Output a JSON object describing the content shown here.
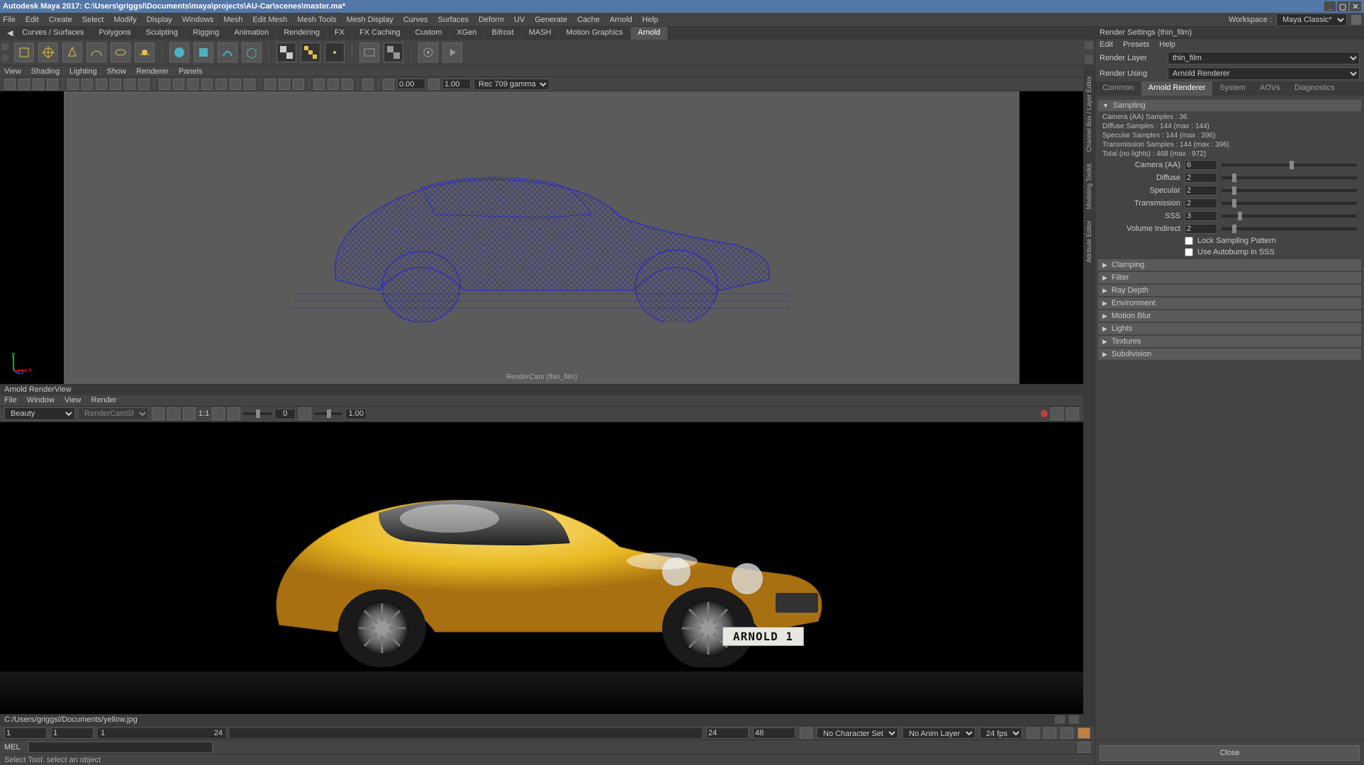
{
  "title_bar": "Autodesk Maya 2017: C:\\Users\\griggsl\\Documents\\maya\\projects\\AU-Car\\scenes\\master.ma*",
  "menus": [
    "File",
    "Edit",
    "Create",
    "Select",
    "Modify",
    "Display",
    "Windows",
    "Mesh",
    "Edit Mesh",
    "Mesh Tools",
    "Mesh Display",
    "Curves",
    "Surfaces",
    "Deform",
    "UV",
    "Generate",
    "Cache",
    "Arnold",
    "Help"
  ],
  "workspace": {
    "label": "Workspace :",
    "value": "Maya Classic*"
  },
  "shelf_tabs": [
    "Curves / Surfaces",
    "Polygons",
    "Sculpting",
    "Rigging",
    "Animation",
    "Rendering",
    "FX",
    "FX Caching",
    "Custom",
    "XGen",
    "Bifrost",
    "MASH",
    "Motion Graphics",
    "Arnold"
  ],
  "shelf_active": "Arnold",
  "viewport_menus": [
    "View",
    "Shading",
    "Lighting",
    "Show",
    "Renderer",
    "Panels"
  ],
  "viewport_toolbar": {
    "exposure": "0.00",
    "gamma": "1.00",
    "colorspace": "Rec 709 gamma"
  },
  "viewport_cam_label": "RenderCam (thin_film)",
  "side_tabs": [
    "Channel Box / Layer Editor",
    "Modeling Toolkit",
    "Attribute Editor"
  ],
  "renderview": {
    "title": "Arnold RenderView",
    "menus": [
      "File",
      "Window",
      "View",
      "Render"
    ],
    "aov": "Beauty",
    "cam": "RenderCamShape",
    "exposure": "0",
    "gamma": "1.00",
    "ratio": "1:1",
    "license_plate": "ARNOLD 1",
    "file_path": "C:/Users/griggsl/Documents/yellow.jpg"
  },
  "timeline": {
    "start_range": "1",
    "start": "1",
    "track_start": "1",
    "track_end": "24",
    "end": "24",
    "end_range": "48",
    "char_set": "No Character Set",
    "anim_layer": "No Anim Layer",
    "fps": "24 fps"
  },
  "mel_label": "MEL",
  "status_line": "Select Tool: select an object",
  "render_settings": {
    "panel_title": "Render Settings (thin_film)",
    "menus": [
      "Edit",
      "Presets",
      "Help"
    ],
    "layer_label": "Render Layer",
    "layer": "thin_film",
    "using_label": "Render Using",
    "using": "Arnold Renderer",
    "tabs": [
      "Common",
      "Arnold Renderer",
      "System",
      "AOVs",
      "Diagnostics"
    ],
    "active_tab": "Arnold Renderer",
    "sampling_header": "Sampling",
    "stats": [
      "Camera (AA) Samples : 36",
      "Diffuse Samples : 144 (max : 144)",
      "Specular Samples : 144 (max : 396)",
      "Transmission Samples : 144 (max : 396)",
      "Total (no lights) : 468 (max : 972)"
    ],
    "params": [
      {
        "name": "Camera (AA)",
        "value": "6",
        "pos": 50
      },
      {
        "name": "Diffuse",
        "value": "2",
        "pos": 8
      },
      {
        "name": "Specular",
        "value": "2",
        "pos": 8
      },
      {
        "name": "Transmission",
        "value": "2",
        "pos": 8
      },
      {
        "name": "SSS",
        "value": "3",
        "pos": 12
      },
      {
        "name": "Volume Indirect",
        "value": "2",
        "pos": 8
      }
    ],
    "checks": [
      {
        "label": "Lock Sampling Pattern",
        "checked": false
      },
      {
        "label": "Use Autobump in SSS",
        "checked": false
      }
    ],
    "sections": [
      "Clamping",
      "Filter",
      "Ray Depth",
      "Environment",
      "Motion Blur",
      "Lights",
      "Textures",
      "Subdivision"
    ],
    "close": "Close"
  }
}
